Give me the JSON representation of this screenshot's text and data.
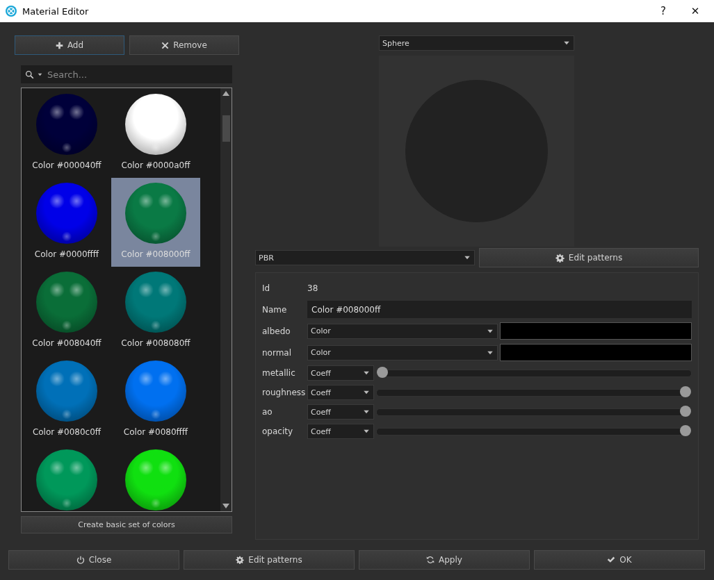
{
  "window": {
    "title": "Material Editor",
    "help_button": "?",
    "close_button": "✕"
  },
  "library": {
    "add_button": "Add",
    "remove_button": "Remove",
    "search": {
      "placeholder": "Search..."
    },
    "materials": [
      {
        "label": "Color #000040ff",
        "color": "#00003a",
        "selected": false
      },
      {
        "label": "Color #0000a0ff",
        "color": "#ffffff",
        "selected": false
      },
      {
        "label": "Color #0000ffff",
        "color": "#0000e8",
        "selected": false
      },
      {
        "label": "Color #008000ff",
        "color": "#0a7a45",
        "selected": true
      },
      {
        "label": "Color #008040ff",
        "color": "#0a6e38",
        "selected": false
      },
      {
        "label": "Color #008080ff",
        "color": "#007878",
        "selected": false
      },
      {
        "label": "Color #0080c0ff",
        "color": "#0070b8",
        "selected": false
      },
      {
        "label": "Color #0080ffff",
        "color": "#0070f0",
        "selected": false
      },
      {
        "color": "#00985a",
        "selected": false
      },
      {
        "color": "#10e010",
        "selected": false
      }
    ],
    "create_button": "Create basic set of colors"
  },
  "preview": {
    "shape": "Sphere"
  },
  "editor": {
    "model": "PBR",
    "edit_patterns_button": "Edit patterns",
    "id": {
      "label": "Id",
      "value": "38"
    },
    "name": {
      "label": "Name",
      "value": "Color #008000ff"
    },
    "properties": [
      {
        "label": "albedo",
        "kind": "color",
        "mode": "Color",
        "color": "#000000"
      },
      {
        "label": "normal",
        "kind": "color",
        "mode": "Color",
        "color": "#000000"
      },
      {
        "label": "metallic",
        "kind": "slider",
        "mode": "Coeff",
        "level": 0
      },
      {
        "label": "roughness",
        "kind": "slider",
        "mode": "Coeff",
        "level": 1
      },
      {
        "label": "ao",
        "kind": "slider",
        "mode": "Coeff",
        "level": 1
      },
      {
        "label": "opacity",
        "kind": "slider",
        "mode": "Coeff",
        "level": 1
      }
    ]
  },
  "buttons": [
    {
      "label": "Close",
      "kind": "power"
    },
    {
      "label": "Edit patterns",
      "kind": "gear"
    },
    {
      "label": "Apply",
      "kind": "refresh"
    },
    {
      "label": "OK",
      "kind": "check"
    }
  ]
}
